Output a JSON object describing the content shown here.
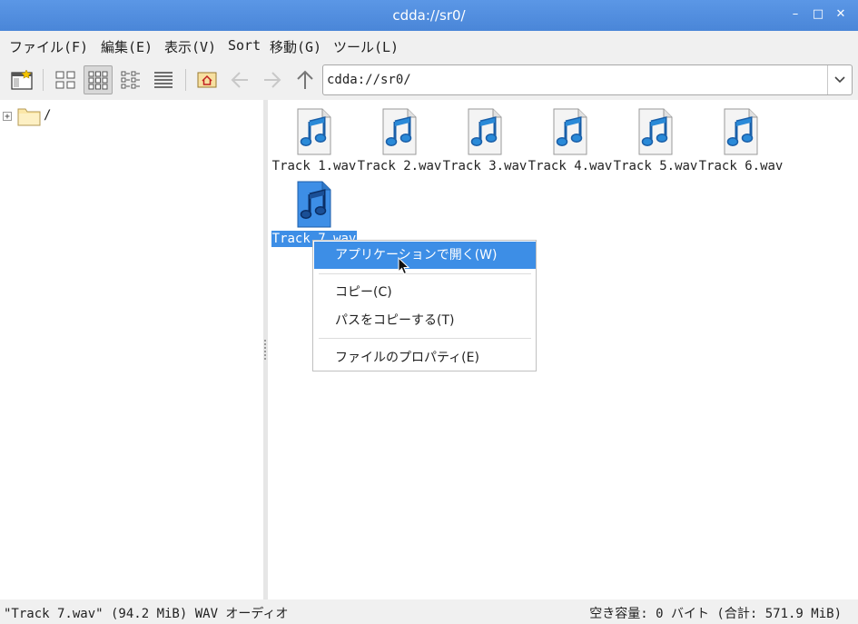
{
  "window": {
    "title": "cdda://sr0/"
  },
  "menu": [
    "ファイル(F)",
    "編集(E)",
    "表示(V)",
    "Sort",
    "移動(G)",
    "ツール(L)"
  ],
  "toolbar": {
    "path": "cdda://sr0/"
  },
  "tree": {
    "root": "/"
  },
  "files": [
    {
      "name": "Track 1.wav"
    },
    {
      "name": "Track 2.wav"
    },
    {
      "name": "Track 3.wav"
    },
    {
      "name": "Track 4.wav"
    },
    {
      "name": "Track 5.wav"
    },
    {
      "name": "Track 6.wav"
    },
    {
      "name": "Track 7.wav",
      "selected": true
    }
  ],
  "context_menu": {
    "open_with": "アプリケーションで開く(W)",
    "copy": "コピー(C)",
    "copy_path": "パスをコピーする(T)",
    "properties": "ファイルのプロパティ(E)"
  },
  "status": {
    "left": "\"Track 7.wav\" (94.2 MiB) WAV オーディオ",
    "right": "空き容量: 0 バイト (合計: 571.9 MiB)"
  },
  "colors": {
    "selection": "#3d8ee6",
    "titlebar": "#4a86d8"
  }
}
